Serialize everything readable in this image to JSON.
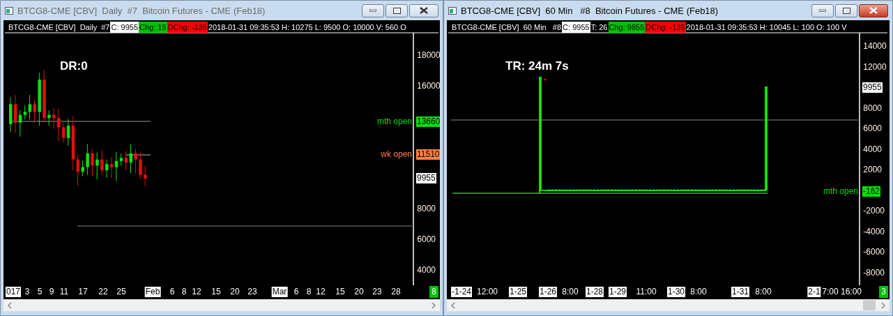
{
  "windows": [
    {
      "title": "BTCG8-CME [CBV]  Daily  #7  Bitcoin Futures - CME (Feb18)",
      "active": false,
      "scroll_thumb": false,
      "info": [
        {
          "kind": "plain",
          "text": "BTCG8-CME [CBV]  Daily  #7"
        },
        {
          "kind": "white",
          "text": "C: 9955"
        },
        {
          "kind": "green",
          "text": "Chg: 15"
        },
        {
          "kind": "red",
          "text": "DChg: -135"
        },
        {
          "kind": "plain",
          "text": "2018-01-31 09:35:53 H: 10275 L: 9500 O: 10000 V: 560 O"
        }
      ],
      "timer": "DR:0",
      "y_ticks": [
        "18000",
        "16000",
        "8000",
        "6000",
        "4000"
      ],
      "price_tags": [
        {
          "label": "mth open",
          "value": "13660",
          "color": "#00e000"
        },
        {
          "label": "wk open",
          "value": "11510",
          "color": "#ff7f40"
        },
        {
          "value": "9955",
          "color": "#ffffff"
        }
      ],
      "x_labels": [
        {
          "text": "017",
          "boxed": true
        },
        {
          "text": "3",
          "boxed": false
        },
        {
          "text": "5",
          "boxed": false
        },
        {
          "text": "9",
          "boxed": false
        },
        {
          "text": "11",
          "boxed": false
        },
        {
          "text": "17",
          "boxed": false
        },
        {
          "text": "22",
          "boxed": false
        },
        {
          "text": "25",
          "boxed": false
        },
        {
          "text": "Feb",
          "boxed": true
        },
        {
          "text": "6",
          "boxed": false
        },
        {
          "text": "8",
          "boxed": false
        },
        {
          "text": "12",
          "boxed": false
        },
        {
          "text": "15",
          "boxed": false
        },
        {
          "text": "20",
          "boxed": false
        },
        {
          "text": "23",
          "boxed": false
        },
        {
          "text": "Mar",
          "boxed": true
        },
        {
          "text": "6",
          "boxed": false
        },
        {
          "text": "8",
          "boxed": false
        },
        {
          "text": "12",
          "boxed": false
        },
        {
          "text": "15",
          "boxed": false
        },
        {
          "text": "20",
          "boxed": false
        },
        {
          "text": "23",
          "boxed": false
        },
        {
          "text": "28",
          "boxed": false
        }
      ],
      "bar_count": "8"
    },
    {
      "title": "BTCG8-CME [CBV]  60 Min   #8  Bitcoin Futures - CME (Feb18)",
      "active": true,
      "scroll_thumb": true,
      "info": [
        {
          "kind": "plain",
          "text": "BTCG8-CME [CBV]  60 Min   #8"
        },
        {
          "kind": "white",
          "text": "C: 9955"
        },
        {
          "kind": "plain",
          "text": "T: 26"
        },
        {
          "kind": "green",
          "text": "Chg: 9855"
        },
        {
          "kind": "red",
          "text": "DChg: -135"
        },
        {
          "kind": "plain",
          "text": "2018-01-31 09:35:53 H: 10045 L: 100 O: 100 V"
        }
      ],
      "timer": "TR: 24m 7s",
      "y_ticks": [
        "14000",
        "12000",
        "8000",
        "6000",
        "4000",
        "2000",
        "-2000",
        "-4000",
        "-6000",
        "-8000"
      ],
      "price_tags": [
        {
          "value": "9955",
          "color": "#ffffff"
        },
        {
          "label": "mth open",
          "value": "-162",
          "color": "#00e000"
        }
      ],
      "x_labels": [
        {
          "text": "-1-24",
          "boxed": true
        },
        {
          "text": "12:00",
          "boxed": false
        },
        {
          "text": "1-25",
          "boxed": true
        },
        {
          "text": "1-26",
          "boxed": true
        },
        {
          "text": "8:00",
          "boxed": false
        },
        {
          "text": "1-28",
          "boxed": true
        },
        {
          "text": "1-29",
          "boxed": true
        },
        {
          "text": "11:00",
          "boxed": false
        },
        {
          "text": "1-30",
          "boxed": true
        },
        {
          "text": "8:00",
          "boxed": false
        },
        {
          "text": "1-31",
          "boxed": true
        },
        {
          "text": "8:00",
          "boxed": false
        },
        {
          "text": "2-1",
          "boxed": true
        },
        {
          "text": "7:00",
          "boxed": false
        },
        {
          "text": "16:00",
          "boxed": false
        }
      ],
      "bar_count": "3"
    }
  ]
}
